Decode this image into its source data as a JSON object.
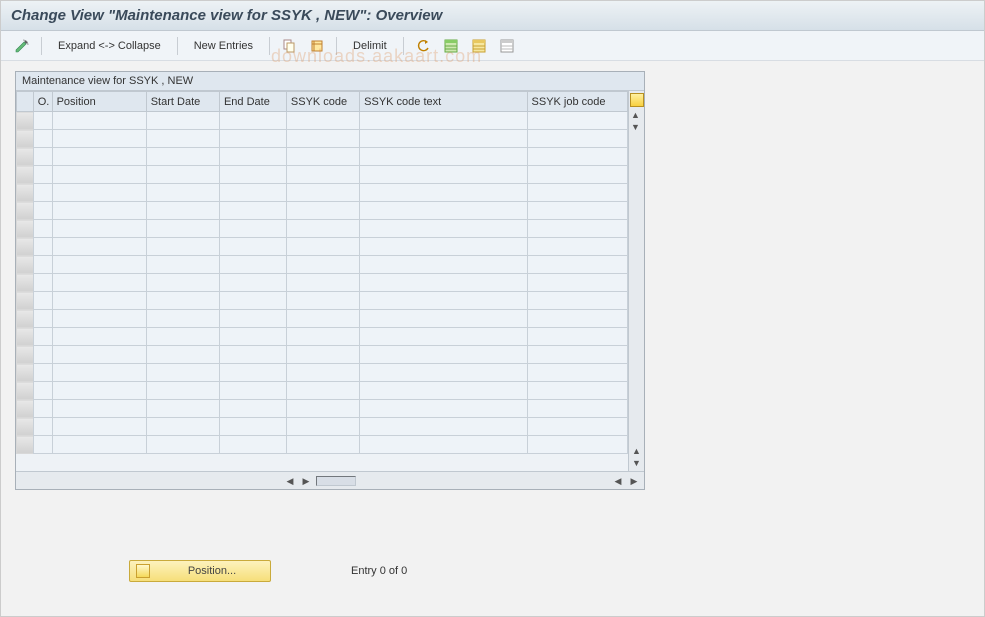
{
  "title": "Change View \"Maintenance view for SSYK , NEW\": Overview",
  "toolbar": {
    "expand_collapse": "Expand <-> Collapse",
    "new_entries": "New Entries",
    "delimit": "Delimit"
  },
  "table": {
    "caption": "Maintenance view for SSYK , NEW",
    "columns": {
      "o": "O.",
      "position": "Position",
      "start_date": "Start Date",
      "end_date": "End Date",
      "ssyk_code": "SSYK code",
      "ssyk_code_text": "SSYK code text",
      "ssyk_job_code": "SSYK job code"
    },
    "row_count_visible": 19
  },
  "footer": {
    "position_button": "Position...",
    "entry_text": "Entry 0 of 0"
  },
  "watermark": "downloads.aakaart.com"
}
